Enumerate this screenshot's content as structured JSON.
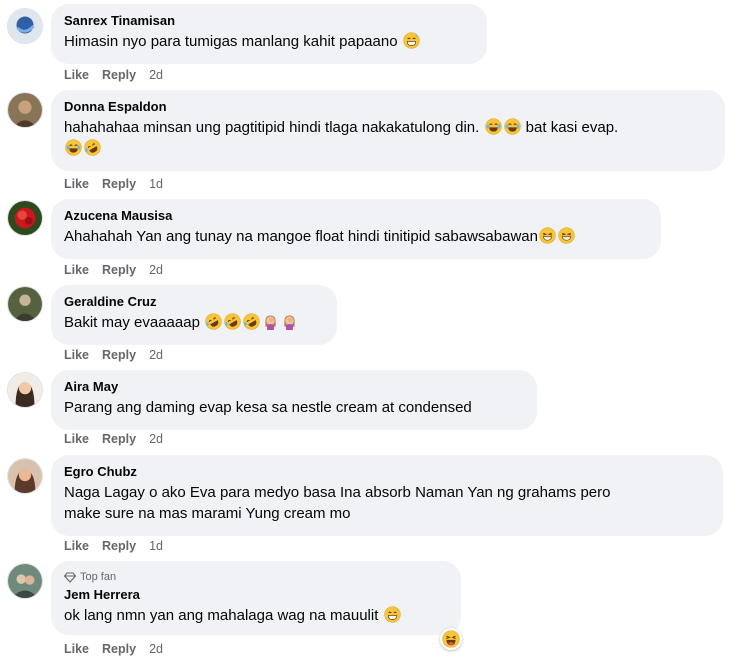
{
  "comments": [
    {
      "author": "Sanrex Tinamisan",
      "text": "Himasin nyo para tumigas manlang kahit papaano",
      "emojis": [
        "grin-sweat-emoji"
      ],
      "like": "Like",
      "reply": "Reply",
      "time": "2d"
    },
    {
      "author": "Donna Espaldon",
      "text_line1": "hahahahaa minsan ung pagtitipid hindi tlaga nakakatulong din.",
      "emojis_mid": [
        "laugh-tears-emoji",
        "laugh-tears-emoji"
      ],
      "text_line1b": "bat kasi evap.",
      "emojis_line2": [
        "laugh-tears-emoji",
        "rofl-emoji"
      ],
      "like": "Like",
      "reply": "Reply",
      "time": "1d"
    },
    {
      "author": "Azucena Mausisa",
      "text": "Ahahahah Yan ang tunay na mangoe float hindi tinitipid sabawsabawan",
      "emojis": [
        "beaming-emoji",
        "beaming-emoji"
      ],
      "like": "Like",
      "reply": "Reply",
      "time": "2d"
    },
    {
      "author": "Geraldine Cruz",
      "text": "Bakit may evaaaaap",
      "emojis": [
        "rofl-emoji",
        "rofl-emoji",
        "rofl-emoji",
        "facepalm-emoji",
        "facepalm-emoji"
      ],
      "like": "Like",
      "reply": "Reply",
      "time": "2d"
    },
    {
      "author": "Aira May",
      "text": "Parang ang daming evap kesa sa nestle cream at condensed",
      "like": "Like",
      "reply": "Reply",
      "time": "2d"
    },
    {
      "author": "Egro Chubz",
      "text_line1": "Naga Lagay o ako Eva para medyo basa Ina absorb Naman Yan ng grahams pero",
      "text_line2": "make sure na mas marami Yung cream mo",
      "like": "Like",
      "reply": "Reply",
      "time": "1d"
    },
    {
      "badge": "Top fan",
      "author": "Jem Herrera",
      "text": "ok lang nmn yan ang mahalaga wag na mauulit",
      "emojis": [
        "grin-sweat-emoji"
      ],
      "reaction": "haha-reaction",
      "like": "Like",
      "reply": "Reply",
      "time": "2d"
    }
  ],
  "colors": {
    "bubble": "#f0f2f5",
    "meta": "#65676b",
    "emoji_yellow": "#f7c53a"
  }
}
